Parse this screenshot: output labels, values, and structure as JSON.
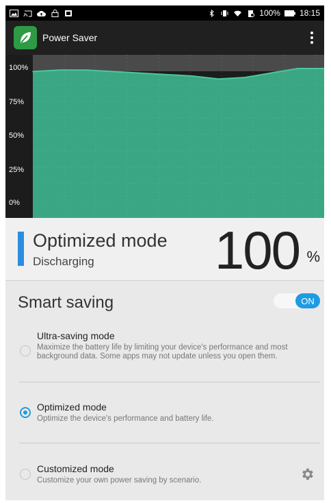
{
  "status_bar": {
    "left_icons": [
      "gallery-icon",
      "cast-icon",
      "cloud-upload-icon",
      "lock-icon",
      "notification-icon"
    ],
    "right_icons": [
      "bluetooth-icon",
      "vibrate-icon",
      "wifi-icon",
      "battery-saver-icon"
    ],
    "battery": "100%",
    "time": "18:15"
  },
  "app_bar": {
    "title": "Power Saver",
    "logo_icon": "leaf-icon",
    "menu_icon": "more-vert-icon"
  },
  "chart_data": {
    "type": "area",
    "yticks": [
      "100%",
      "75%",
      "50%",
      "25%",
      "0%"
    ],
    "ylim": [
      0,
      100
    ],
    "values": [
      98,
      99,
      99,
      98,
      97,
      96,
      95,
      93,
      94,
      97,
      100,
      100
    ],
    "grid": true,
    "colors": {
      "fill": "#3aa683",
      "line": "#4cc79e",
      "background": "#1c1c1c",
      "gap": "#4a4a4a"
    }
  },
  "mode": {
    "name": "Optimized mode",
    "status": "Discharging",
    "percent": "100",
    "unit": "%"
  },
  "smart_saving": {
    "title": "Smart saving",
    "toggle_label": "ON",
    "options": [
      {
        "title": "Ultra-saving mode",
        "description": "Maximize the battery life by limiting your device's performance and most background data. Some apps may not update unless you open them.",
        "selected": false
      },
      {
        "title": "Optimized mode",
        "description": "Optimize the device's performance and battery life.",
        "selected": true
      },
      {
        "title": "Customized mode",
        "description": "Customize your own power saving by scenario.",
        "selected": false
      }
    ],
    "settings_icon": "gear-icon",
    "accent_color": "#1e9be3"
  }
}
